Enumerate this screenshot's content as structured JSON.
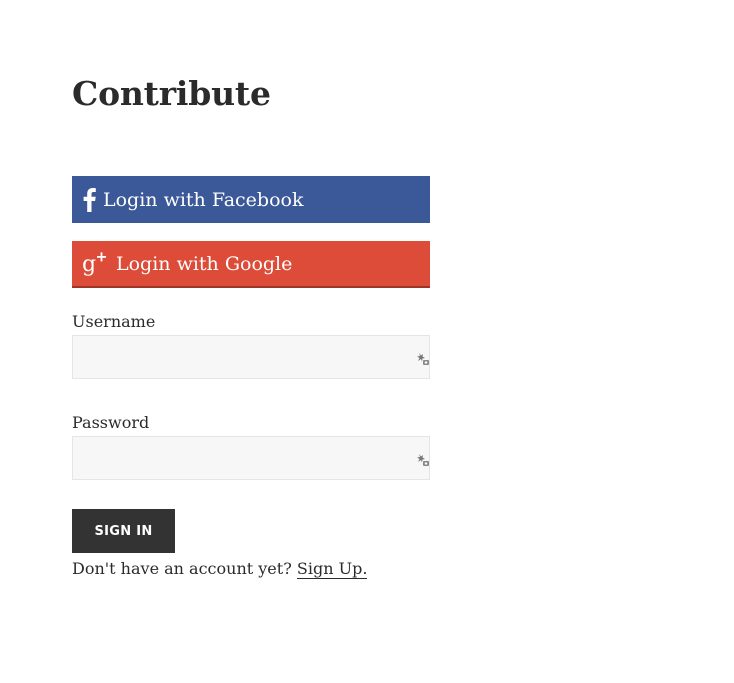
{
  "page": {
    "title": "Contribute"
  },
  "social": {
    "facebook_label": "Login with Facebook",
    "google_label": "Login with Google",
    "facebook_color": "#3b5998",
    "google_color": "#dd4b39"
  },
  "form": {
    "username_label": "Username",
    "username_value": "",
    "password_label": "Password",
    "password_value": "",
    "signin_label": "SIGN IN"
  },
  "footer": {
    "prompt": "Don't have an account yet?",
    "signup_link": "Sign Up."
  },
  "icons": {
    "facebook": "facebook-icon",
    "google": "google-plus-icon",
    "password_manager": "key-icon"
  }
}
